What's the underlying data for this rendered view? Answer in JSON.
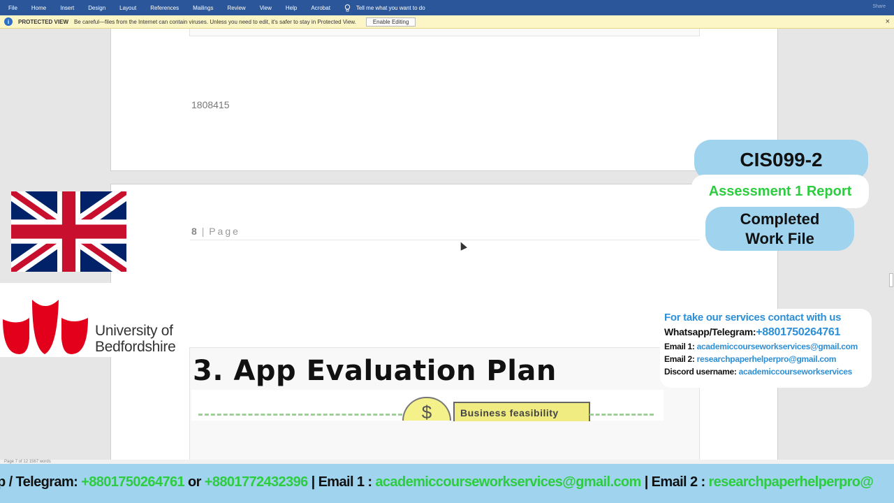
{
  "ribbon": {
    "tabs": [
      "File",
      "Home",
      "Insert",
      "Design",
      "Layout",
      "References",
      "Mailings",
      "Review",
      "View",
      "Help",
      "Acrobat"
    ],
    "tell_me": "Tell me what you want to do",
    "share": "Share"
  },
  "protected_view": {
    "title": "PROTECTED VIEW",
    "message": "Be careful—files from the Internet can contain viruses. Unless you need to edit, it's safer to stay in Protected View.",
    "button": "Enable Editing"
  },
  "document": {
    "page1_number": "1808415",
    "page2_number": "8",
    "page2_label": "Page",
    "slide_heading": "3. App Evaluation Plan",
    "slide_coin": "$",
    "slide_box": "Business  feasibility"
  },
  "status_bar": {
    "text": "Page 7 of 12    1567 words"
  },
  "overlay": {
    "university": "University of Bedfordshire",
    "university_line1": "University of",
    "university_line2": "Bedfordshire",
    "course_code": "CIS099-2",
    "assessment": "Assessment 1 Report",
    "completed_line1": "Completed",
    "completed_line2": "Work File",
    "contact": {
      "heading": "For take our services contact with us",
      "whatsapp_label": "Whatsapp/Telegram:",
      "whatsapp": "+8801750264761",
      "email1_label": "Email 1:",
      "email1": "academiccourseworkservices@gmail.com",
      "email2_label": "Email 2:",
      "email2": "researchpaperhelperpro@gmail.com",
      "discord_label": "Discord username:",
      "discord": "academiccourseworkservices"
    },
    "ticker": {
      "p1": "p / Telegram: ",
      "phone1": "+8801750264761",
      "p2": " or ",
      "phone2": "+8801772432396",
      "p3": " | Email 1 : ",
      "email1": "academiccourseworkservices@gmail.com",
      "p4": " | Email 2 : ",
      "email2": "researchpaperhelperpro@"
    }
  },
  "colors": {
    "ribbon": "#2b579a",
    "badge": "#9fd3ee",
    "accent_green": "#2ecc40",
    "accent_blue": "#2d8fd6",
    "flag_red": "#c8102e",
    "flag_blue": "#012169",
    "logo_red": "#e3001b"
  }
}
